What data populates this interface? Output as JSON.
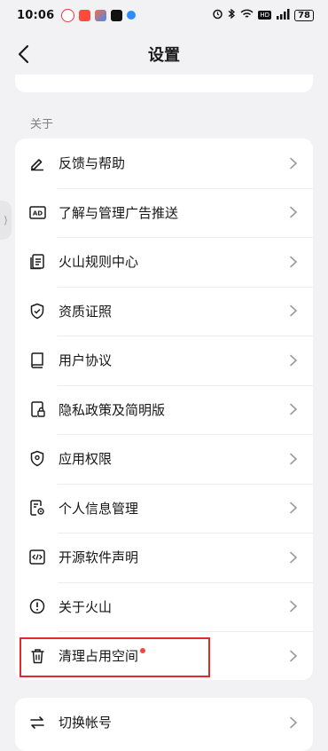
{
  "status_bar": {
    "time": "10:06",
    "battery": "78"
  },
  "header": {
    "title": "设置"
  },
  "section": {
    "about_label": "关于"
  },
  "items": [
    {
      "label": "反馈与帮助",
      "icon": "pencil-icon"
    },
    {
      "label": "了解与管理广告推送",
      "icon": "ad-icon"
    },
    {
      "label": "火山规则中心",
      "icon": "document-icon"
    },
    {
      "label": "资质证照",
      "icon": "shield-check-icon"
    },
    {
      "label": "用户协议",
      "icon": "book-icon"
    },
    {
      "label": "隐私政策及简明版",
      "icon": "lock-doc-icon"
    },
    {
      "label": "应用权限",
      "icon": "location-shield-icon"
    },
    {
      "label": "个人信息管理",
      "icon": "doc-settings-icon"
    },
    {
      "label": "开源软件声明",
      "icon": "code-icon"
    },
    {
      "label": "关于火山",
      "icon": "info-icon"
    },
    {
      "label": "清理占用空间",
      "icon": "trash-icon"
    }
  ],
  "switch_account": {
    "label": "切换帐号",
    "icon": "switch-icon"
  },
  "colors": {
    "highlight": "#e5282e",
    "badge": "#f2463b"
  }
}
